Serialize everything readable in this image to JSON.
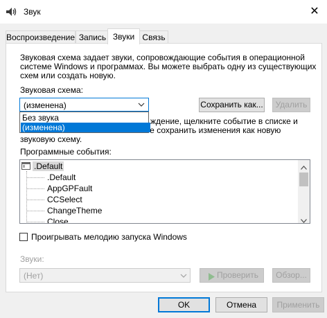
{
  "window": {
    "title": "Звук",
    "close_glyph": "✕"
  },
  "tabs": [
    {
      "label": "Воспроизведение",
      "active": false
    },
    {
      "label": "Запись",
      "active": false
    },
    {
      "label": "Звуки",
      "active": true
    },
    {
      "label": "Связь",
      "active": false
    }
  ],
  "content": {
    "description": {
      "line1": "Звуковая схема задает звуки, сопровождающие события в операционной",
      "line2": "системе Windows и программах. Вы можете выбрать одну из существующих",
      "line3": "схем или создать новую."
    },
    "scheme_label": "Звуковая схема:",
    "scheme_value": "(изменена)",
    "scheme_options": [
      "Без звука",
      "(изменена)"
    ],
    "save_as_label": "Сохранить как...",
    "delete_label": "Удалить",
    "info_partial": {
      "line1": "ждение, щелкните событие в списке и",
      "line2": "выберите нужный звук. Вы можете сохранить изменения как новую",
      "line3": "звуковую схему."
    },
    "events_label": "Программные события:",
    "events": {
      "root": ".Default",
      "children": [
        ".Default",
        "AppGPFault",
        "CCSelect",
        "ChangeTheme",
        "Close"
      ]
    },
    "startup_checkbox_label": "Проигрывать мелодию запуска Windows",
    "startup_checked": false,
    "sounds_label": "Звуки:",
    "sound_value": "(Нет)",
    "test_label": "Проверить",
    "browse_label": "Обзор..."
  },
  "footer": {
    "ok_label": "OK",
    "cancel_label": "Отмена",
    "apply_label": "Применить"
  },
  "colors": {
    "accent": "#0078d7",
    "disabled_text": "#a0a0a0",
    "selection": "#0078d7"
  }
}
